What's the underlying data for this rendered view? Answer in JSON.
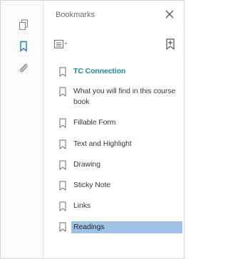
{
  "panel": {
    "title": "Bookmarks"
  },
  "icons": {
    "rail": [
      "pages-icon",
      "bookmark-icon",
      "attachments-icon"
    ],
    "toolbar": [
      "options-menu-icon",
      "add-bookmark-icon"
    ],
    "close": "close-icon"
  },
  "colors": {
    "active_bookmark": "#1a8a9c",
    "selected_highlight": "#9fc1e6",
    "rail_active": "#2f6fd0"
  },
  "bookmarks": [
    {
      "label": "TC Connection",
      "state": "active"
    },
    {
      "label": "What you will find in this course book",
      "state": "normal"
    },
    {
      "label": "Fillable Form",
      "state": "normal"
    },
    {
      "label": "Text and Highlight",
      "state": "normal"
    },
    {
      "label": "Drawing",
      "state": "normal"
    },
    {
      "label": "Sticky Note",
      "state": "normal"
    },
    {
      "label": "Links",
      "state": "normal"
    },
    {
      "label": "Readings",
      "state": "selected"
    }
  ]
}
